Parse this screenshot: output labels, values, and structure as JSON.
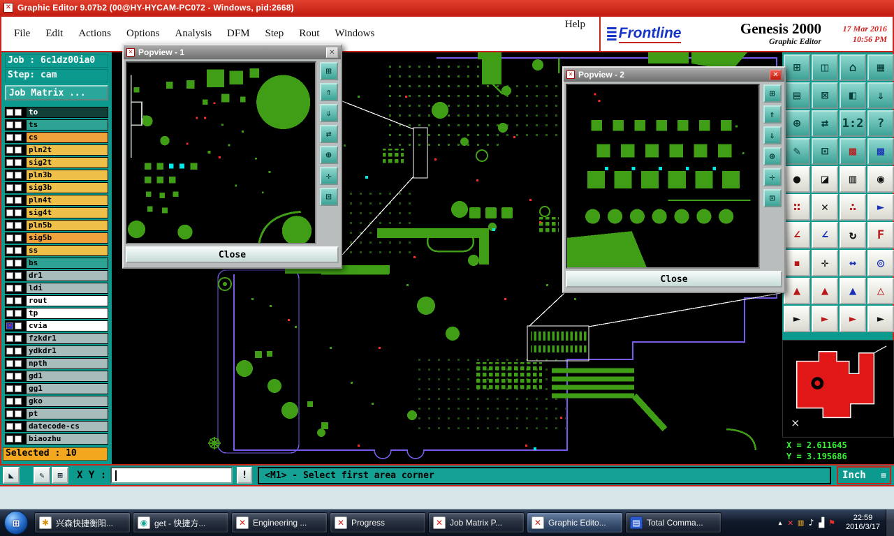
{
  "palette": {
    "teal": "#0d9a8e",
    "red": "#c8231c",
    "pcb_green": "#3f9e16",
    "outline_purple": "#7a5ae8",
    "mark_red": "#ff2a2a",
    "mark_cyan": "#00e8e8",
    "chip_yellow": "#eec04a",
    "chip_orange": "#f0a23c",
    "selected_yellow": "#f2a71f"
  },
  "icons": {
    "titlebar_app": "✕",
    "popview_app": "✕",
    "close": "✕",
    "start": "⊞",
    "units_menu": "▤",
    "brand_bars": "≣"
  },
  "titlebar": {
    "title": "Graphic Editor 9.07b2 (00@HY-HYCAM-PC072 - Windows, pid:2668)"
  },
  "menubar": {
    "items": [
      {
        "dn": "menu-file",
        "label": "File"
      },
      {
        "dn": "menu-edit",
        "label": "Edit"
      },
      {
        "dn": "menu-actions",
        "label": "Actions"
      },
      {
        "dn": "menu-options",
        "label": "Options"
      },
      {
        "dn": "menu-analysis",
        "label": "Analysis"
      },
      {
        "dn": "menu-dfm",
        "label": "DFM"
      },
      {
        "dn": "menu-step",
        "label": "Step"
      },
      {
        "dn": "menu-rout",
        "label": "Rout"
      },
      {
        "dn": "menu-windows",
        "label": "Windows"
      }
    ],
    "help": "Help"
  },
  "brand": {
    "logo_text": "Frontline",
    "product": "Genesis 2000",
    "date": "17 Mar 2016",
    "time": "10:56 PM",
    "subtitle": "Graphic Editor"
  },
  "sidebar": {
    "job": "Job : 6c1dz00ia0",
    "step": "Step: cam",
    "job_matrix": "Job Matrix ...",
    "selected": "Selected : 10",
    "layers": [
      {
        "name": "to",
        "color": "#123f38",
        "fg": "#ffffff"
      },
      {
        "name": "ts",
        "color": "#2fa393",
        "fg": "#000000"
      },
      {
        "name": "cs",
        "color": "#f0a23c",
        "fg": "#000000"
      },
      {
        "name": "pln2t",
        "color": "#eec04a",
        "fg": "#000000"
      },
      {
        "name": "sig2t",
        "color": "#eec04a",
        "fg": "#000000"
      },
      {
        "name": "pln3b",
        "color": "#eec04a",
        "fg": "#000000"
      },
      {
        "name": "sig3b",
        "color": "#eec04a",
        "fg": "#000000"
      },
      {
        "name": "pln4t",
        "color": "#eec04a",
        "fg": "#000000"
      },
      {
        "name": "sig4t",
        "color": "#eec04a",
        "fg": "#000000"
      },
      {
        "name": "pln5b",
        "color": "#eec04a",
        "fg": "#000000"
      },
      {
        "name": "sig5b",
        "color": "#f0a23c",
        "fg": "#000000"
      },
      {
        "name": "ss",
        "color": "#eec04a",
        "fg": "#000000"
      },
      {
        "name": "bs",
        "color": "#2fa393",
        "fg": "#000000"
      },
      {
        "name": "dr1",
        "color": "#a9bcbc",
        "fg": "#000000"
      },
      {
        "name": "ldi",
        "color": "#a9bcbc",
        "fg": "#000000"
      },
      {
        "name": "rout",
        "color": "#ffffff",
        "fg": "#000000"
      },
      {
        "name": "tp",
        "color": "#ffffff",
        "fg": "#000000"
      },
      {
        "name": "cvia",
        "color": "#ffffff",
        "fg": "#000000",
        "cls": "marked"
      },
      {
        "name": "fzkdr1",
        "color": "#a9bcbc",
        "fg": "#000000"
      },
      {
        "name": "ydkdr1",
        "color": "#a9bcbc",
        "fg": "#000000"
      },
      {
        "name": "npth",
        "color": "#a9bcbc",
        "fg": "#000000"
      },
      {
        "name": "gd1",
        "color": "#a9bcbc",
        "fg": "#000000"
      },
      {
        "name": "gg1",
        "color": "#a9bcbc",
        "fg": "#000000"
      },
      {
        "name": "gko",
        "color": "#a9bcbc",
        "fg": "#000000"
      },
      {
        "name": "pt",
        "color": "#a9bcbc",
        "fg": "#000000"
      },
      {
        "name": "datecode-cs",
        "color": "#a9bcbc",
        "fg": "#000000"
      },
      {
        "name": "biaozhu",
        "color": "#a9bcbc",
        "fg": "#000000"
      }
    ]
  },
  "toolbar": {
    "buttons": [
      {
        "dn": "copy-view-button",
        "glyph": "⊞",
        "cls": "teal"
      },
      {
        "dn": "dual-monitor-button",
        "glyph": "◫",
        "cls": "teal"
      },
      {
        "dn": "home-view-button",
        "glyph": "⌂",
        "cls": "teal"
      },
      {
        "dn": "tile-windows-button",
        "glyph": "▦",
        "cls": "teal"
      },
      {
        "dn": "panel-view-button",
        "glyph": "▤",
        "cls": "teal"
      },
      {
        "dn": "capture-view-button",
        "glyph": "⊠",
        "cls": "teal"
      },
      {
        "dn": "split-view-button",
        "glyph": "◧",
        "cls": "teal"
      },
      {
        "dn": "send-down-button",
        "glyph": "⇓",
        "cls": "teal"
      },
      {
        "dn": "zoom-target-button",
        "glyph": "⊕",
        "cls": "teal"
      },
      {
        "dn": "swap-view-button",
        "glyph": "⇄",
        "cls": "teal"
      },
      {
        "dn": "scale-1-2-button",
        "glyph": "1:2",
        "cls": "teal"
      },
      {
        "dn": "help-button",
        "glyph": "?",
        "cls": "teal"
      },
      {
        "dn": "annotate-button",
        "glyph": "✎",
        "cls": "teal"
      },
      {
        "dn": "measure-box-button",
        "glyph": "⊡",
        "cls": "teal"
      },
      {
        "dn": "grid-red-button",
        "glyph": "▩",
        "cls": "teal",
        "fg": "#b81818"
      },
      {
        "dn": "grid-blue-button",
        "glyph": "▩",
        "cls": "teal",
        "fg": "#1830b8"
      },
      {
        "dn": "dot-tool-button",
        "glyph": "●",
        "cls": "white",
        "fg": "#111111"
      },
      {
        "dn": "fill-corner-button",
        "glyph": "◪",
        "cls": "white",
        "fg": "#111111"
      },
      {
        "dn": "ruler-button",
        "glyph": "▥",
        "cls": "white",
        "fg": "#111111"
      },
      {
        "dn": "circle-select-button",
        "glyph": "◉",
        "cls": "white",
        "fg": "#111111"
      },
      {
        "dn": "cluster-tool-button",
        "glyph": "∷",
        "cls": "white",
        "fg": "#b81818"
      },
      {
        "dn": "delete-tool-button",
        "glyph": "✕",
        "cls": "white",
        "fg": "#111111"
      },
      {
        "dn": "scatter-tool-button",
        "glyph": "∴",
        "cls": "white",
        "fg": "#b81818"
      },
      {
        "dn": "vector-tool-button",
        "glyph": "►",
        "cls": "white",
        "fg": "#1830b8"
      },
      {
        "dn": "angle-red-button",
        "glyph": "∠",
        "cls": "white",
        "fg": "#b81818"
      },
      {
        "dn": "angle-blue-button",
        "glyph": "∠",
        "cls": "white",
        "fg": "#1830b8"
      },
      {
        "dn": "rotate-button",
        "glyph": "↻",
        "cls": "white",
        "fg": "#111111"
      },
      {
        "dn": "flip-f-button",
        "glyph": "F",
        "cls": "white",
        "fg": "#b81818"
      },
      {
        "dn": "pad-red-button",
        "glyph": "▪",
        "cls": "white",
        "fg": "#b81818"
      },
      {
        "dn": "crosshair-button",
        "glyph": "✛",
        "cls": "white",
        "fg": "#111111"
      },
      {
        "dn": "stretch-button",
        "glyph": "↔",
        "cls": "white",
        "fg": "#1830b8"
      },
      {
        "dn": "target-blue-button",
        "glyph": "◎",
        "cls": "white",
        "fg": "#1830b8"
      },
      {
        "dn": "triangle-a1-button",
        "glyph": "▲",
        "cls": "white",
        "fg": "#b81818"
      },
      {
        "dn": "triangle-a2-button",
        "glyph": "▲",
        "cls": "white",
        "fg": "#b81818"
      },
      {
        "dn": "triangle-a3-button",
        "glyph": "▲",
        "cls": "white",
        "fg": "#1830b8"
      },
      {
        "dn": "triangle-a4-button",
        "glyph": "△",
        "cls": "white",
        "fg": "#b81818"
      },
      {
        "dn": "cursor-black-button",
        "glyph": "►",
        "cls": "white",
        "fg": "#111111"
      },
      {
        "dn": "cursor-red-button",
        "glyph": "►",
        "cls": "white",
        "fg": "#b81818"
      },
      {
        "dn": "cursor-curve-button",
        "glyph": "►",
        "cls": "white",
        "fg": "#b81818"
      },
      {
        "dn": "cursor-dots-button",
        "glyph": "►",
        "cls": "white",
        "fg": "#111111"
      }
    ]
  },
  "popview1": {
    "title": "Popview - 1",
    "close": "Close",
    "buttons": [
      {
        "dn": "pv1-detach-button",
        "glyph": "⊞"
      },
      {
        "dn": "pv1-scroll-up-button",
        "glyph": "⇑"
      },
      {
        "dn": "pv1-scroll-down-button",
        "glyph": "⇓"
      },
      {
        "dn": "pv1-pan-button",
        "glyph": "⇄"
      },
      {
        "dn": "pv1-zoom-button",
        "glyph": "⊕"
      },
      {
        "dn": "pv1-center-button",
        "glyph": "✛"
      },
      {
        "dn": "pv1-move-button",
        "glyph": "⊡"
      }
    ]
  },
  "popview2": {
    "title": "Popview - 2",
    "close": "Close",
    "buttons": [
      {
        "dn": "pv2-detach-button",
        "glyph": "⊞"
      },
      {
        "dn": "pv2-scroll-up-button",
        "glyph": "⇑"
      },
      {
        "dn": "pv2-scroll-down-button",
        "glyph": "⇓"
      },
      {
        "dn": "pv2-zoom-button",
        "glyph": "⊕"
      },
      {
        "dn": "pv2-center-button",
        "glyph": "✛"
      },
      {
        "dn": "pv2-move-button",
        "glyph": "⊡"
      }
    ]
  },
  "overview": {
    "x": "X = 2.611645",
    "y": "Y = 3.195686"
  },
  "statusbar": {
    "buttons": [
      {
        "dn": "snap-corner-button",
        "glyph": "◣"
      },
      {
        "dn": "draw-line-button",
        "glyph": "✎"
      },
      {
        "dn": "grid-button",
        "glyph": "⊞"
      }
    ],
    "xy_label": "X Y :",
    "input_value": "",
    "alert_label": "!",
    "prompt": "<M1> - Select first area corner",
    "units": "Inch"
  },
  "taskbar": {
    "items": [
      {
        "label": "兴森快捷衡阳...",
        "icon_glyph": "✱",
        "icon_fg": "#d89010",
        "icon_bg": "#ffffff"
      },
      {
        "label": "get - 快捷方...",
        "icon_glyph": "◉",
        "icon_fg": "#18a898",
        "icon_bg": "#ffffff"
      },
      {
        "label": "Engineering ...",
        "icon_glyph": "✕",
        "icon_fg": "#d42316",
        "icon_bg": "#ffffff"
      },
      {
        "label": "Progress",
        "icon_glyph": "✕",
        "icon_fg": "#d42316",
        "icon_bg": "#ffffff"
      },
      {
        "label": "Job Matrix P...",
        "icon_glyph": "✕",
        "icon_fg": "#d42316",
        "icon_bg": "#ffffff"
      },
      {
        "label": "Graphic Edito...",
        "icon_glyph": "✕",
        "icon_fg": "#d42316",
        "icon_bg": "#ffffff",
        "cls": "active"
      },
      {
        "label": "Total Comma...",
        "icon_glyph": "▤",
        "icon_fg": "#ffffff",
        "icon_bg": "#2a5ad0"
      }
    ],
    "tray": [
      {
        "dn": "tray-expand-icon",
        "glyph": "▴",
        "fg": "#ffffff"
      },
      {
        "dn": "tray-genesis-icon",
        "glyph": "✕",
        "fg": "#ff4040"
      },
      {
        "dn": "tray-chart-icon",
        "glyph": "▥",
        "fg": "#e0a020"
      },
      {
        "dn": "tray-volume-icon",
        "glyph": "♪",
        "fg": "#ffffff"
      },
      {
        "dn": "tray-network-icon",
        "glyph": "▟",
        "fg": "#ffffff"
      },
      {
        "dn": "tray-flag-icon",
        "glyph": "⚑",
        "fg": "#e03030"
      }
    ],
    "clock": "22:59",
    "date": "2016/3/17"
  }
}
